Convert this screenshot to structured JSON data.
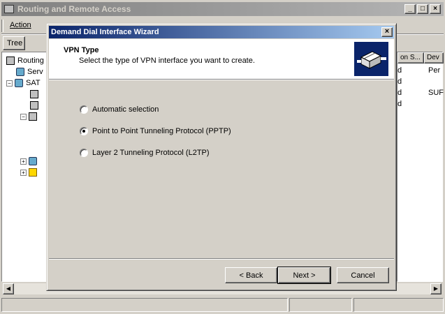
{
  "main_window": {
    "title": "Routing and Remote Access",
    "menu": {
      "action_label": "Action"
    },
    "tree_tab_label": "Tree",
    "tree_items": [
      {
        "label": "Routing"
      },
      {
        "label": "Serv"
      },
      {
        "label": "SAT"
      }
    ],
    "list_headers": [
      "on S...",
      "Dev"
    ],
    "list_rows": [
      {
        "status": "d",
        "device": "Per"
      },
      {
        "status": "d",
        "device": ""
      },
      {
        "status": "d",
        "device": "SUF"
      },
      {
        "status": "d",
        "device": ""
      }
    ]
  },
  "wizard": {
    "title": "Demand Dial Interface Wizard",
    "close_glyph": "×",
    "heading": "VPN Type",
    "subheading": "Select the type of VPN interface you want to create.",
    "options": [
      {
        "label": "Automatic selection",
        "checked": false
      },
      {
        "label": "Point to Point Tunneling Protocol (PPTP)",
        "checked": true
      },
      {
        "label": "Layer 2 Tunneling Protocol (L2TP)",
        "checked": false
      }
    ],
    "buttons": {
      "back": "< Back",
      "next": "Next >",
      "cancel": "Cancel"
    }
  }
}
